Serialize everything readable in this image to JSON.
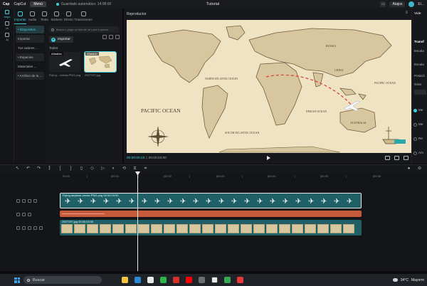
{
  "titlebar": {
    "logo": "Cap",
    "logo2": "CapCut",
    "menu": "Menú",
    "autosave": "Guardado automático: 14:08:00",
    "title": "Tutorial",
    "shortcuts": "Atajos",
    "user": "El..."
  },
  "rail": {
    "items": [
      "Impo",
      "IA",
      "Aj"
    ]
  },
  "tabs": [
    {
      "label": "Importar",
      "icon": "import-icon"
    },
    {
      "label": "Audio",
      "icon": "audio-icon"
    },
    {
      "label": "Texto",
      "icon": "text-icon"
    },
    {
      "label": "Stickers",
      "icon": "sticker-icon"
    },
    {
      "label": "Efecto",
      "icon": "effect-icon"
    },
    {
      "label": "Transiciones",
      "icon": "transition-icon"
    }
  ],
  "sidebar": {
    "items": [
      "• Dispositivo",
      "Importar",
      "Tus valores ...",
      "• Espacios",
      "Materiales ...",
      "• Archivo de la ..."
    ]
  },
  "media": {
    "search_placeholder": "Busca o pega un link de url para importar.",
    "import_label": "Importar",
    "all_label": "Todos",
    "items": [
      {
        "badge": "Añadido",
        "name": "Flying-...ixabay.PNG.png"
      },
      {
        "badge": "Añadido",
        "name": "2927197.jpg"
      }
    ]
  },
  "player": {
    "title": "Reproductor",
    "time_current": "00:00:00:23",
    "time_total": "00:00:03:00",
    "map_labels": {
      "pacific_west": "PACIFIC OCEAN",
      "pacific_east": "PACIFIC OCEAN",
      "north_atlantic": "NORTH ATLANTIC OCEAN",
      "south_atlantic": "SOUTH ATLANTIC OCEAN",
      "indian": "INDIAN OCEAN",
      "russia": "RUSSIA",
      "china": "CHINA",
      "australia": "AUSTRALIA"
    }
  },
  "props": {
    "tab": "Vide",
    "section": "Transf",
    "rows": [
      "Escala",
      "Escala",
      "Posició",
      "Girar",
      "Me",
      "Me",
      "Re",
      "Am"
    ]
  },
  "timeline": {
    "ruler": [
      "00:00",
      "|",
      "|00:01",
      "|",
      "|00:02",
      "|",
      "|00:03",
      "|",
      "|00:04",
      "|",
      "|00:05",
      "|",
      "|00:06"
    ],
    "video_clip_label": "Flying-airplane-vector-PNG.png  00:00:03:00",
    "image_clip_label": "2927197.jpg  00:00:03:00"
  },
  "taskbar": {
    "search": "Buscar",
    "temp": "34°C",
    "weather": "Mayorm"
  },
  "colors": {
    "accent": "#3fcfdc",
    "clip_teal": "#1f5f66",
    "clip_red": "#c85a3c",
    "map_bg": "#efe3c3",
    "map_land": "#d8c79e"
  }
}
